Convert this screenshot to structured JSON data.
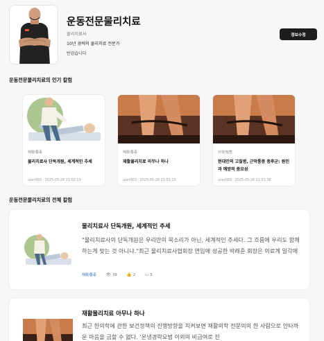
{
  "profile": {
    "name": "운동전문물리치료",
    "role": "물리치료사",
    "tagline": "10년 경력의 물리치료 전문가",
    "greeting": "반갑습니다",
    "edit_button": "정보수정"
  },
  "popular_section": {
    "title": "운동전문물리치료의 인기 칼럼",
    "cards": [
      {
        "category": "재활/통증",
        "title": "물리치료사 단독개원, 세계적인 추세",
        "meta": "user003 · 2025-05-26 21:02:19",
        "thumb": "therapy-illustration"
      },
      {
        "category": "재활/통증",
        "title": "재활물리치료 아무나 하나",
        "meta": "user003 · 2025-05-26 21:01:10",
        "thumb": "rehab-photo"
      },
      {
        "category": "의학/질환",
        "title": "현대인의 고질병, 근막통증 증후군: 원인과 예방의 중요성",
        "meta": "user003 · 2025-05-26 21:01:38",
        "thumb": "rehab-photo"
      }
    ]
  },
  "all_section": {
    "title": "운동전문물리치료의 전체 칼럼",
    "items": [
      {
        "title": "물리치료사 단독개원, 세계적인 추세",
        "excerpt": "\"물리치료사의 단독개원은 우리만의 목소리가 아닌, 세계적인 추세다. 그 흐름에 우리도 함께 하는게 맞는 것 아니냐.\"최근 물리치료사협회장 연임에 성공한 박래준 회장은 의료계 일각에",
        "category": "재활/통증",
        "views": "39",
        "likes": "2",
        "comments": "5"
      },
      {
        "title": "재활물리치료 아무나 하나",
        "excerpt": "최근 한의학에 관한 보건정책의 진행방향을 지켜보면 재활의학 전문의의 한 사람으로 안타까운 마음을 금할 수 없다. '온냉경락요법 이외의 비급여로 진"
      }
    ]
  },
  "colors": {
    "accent_link": "#1d5fd0",
    "button_bg": "#1d1d1f",
    "page_bg": "#f7f7f8"
  }
}
